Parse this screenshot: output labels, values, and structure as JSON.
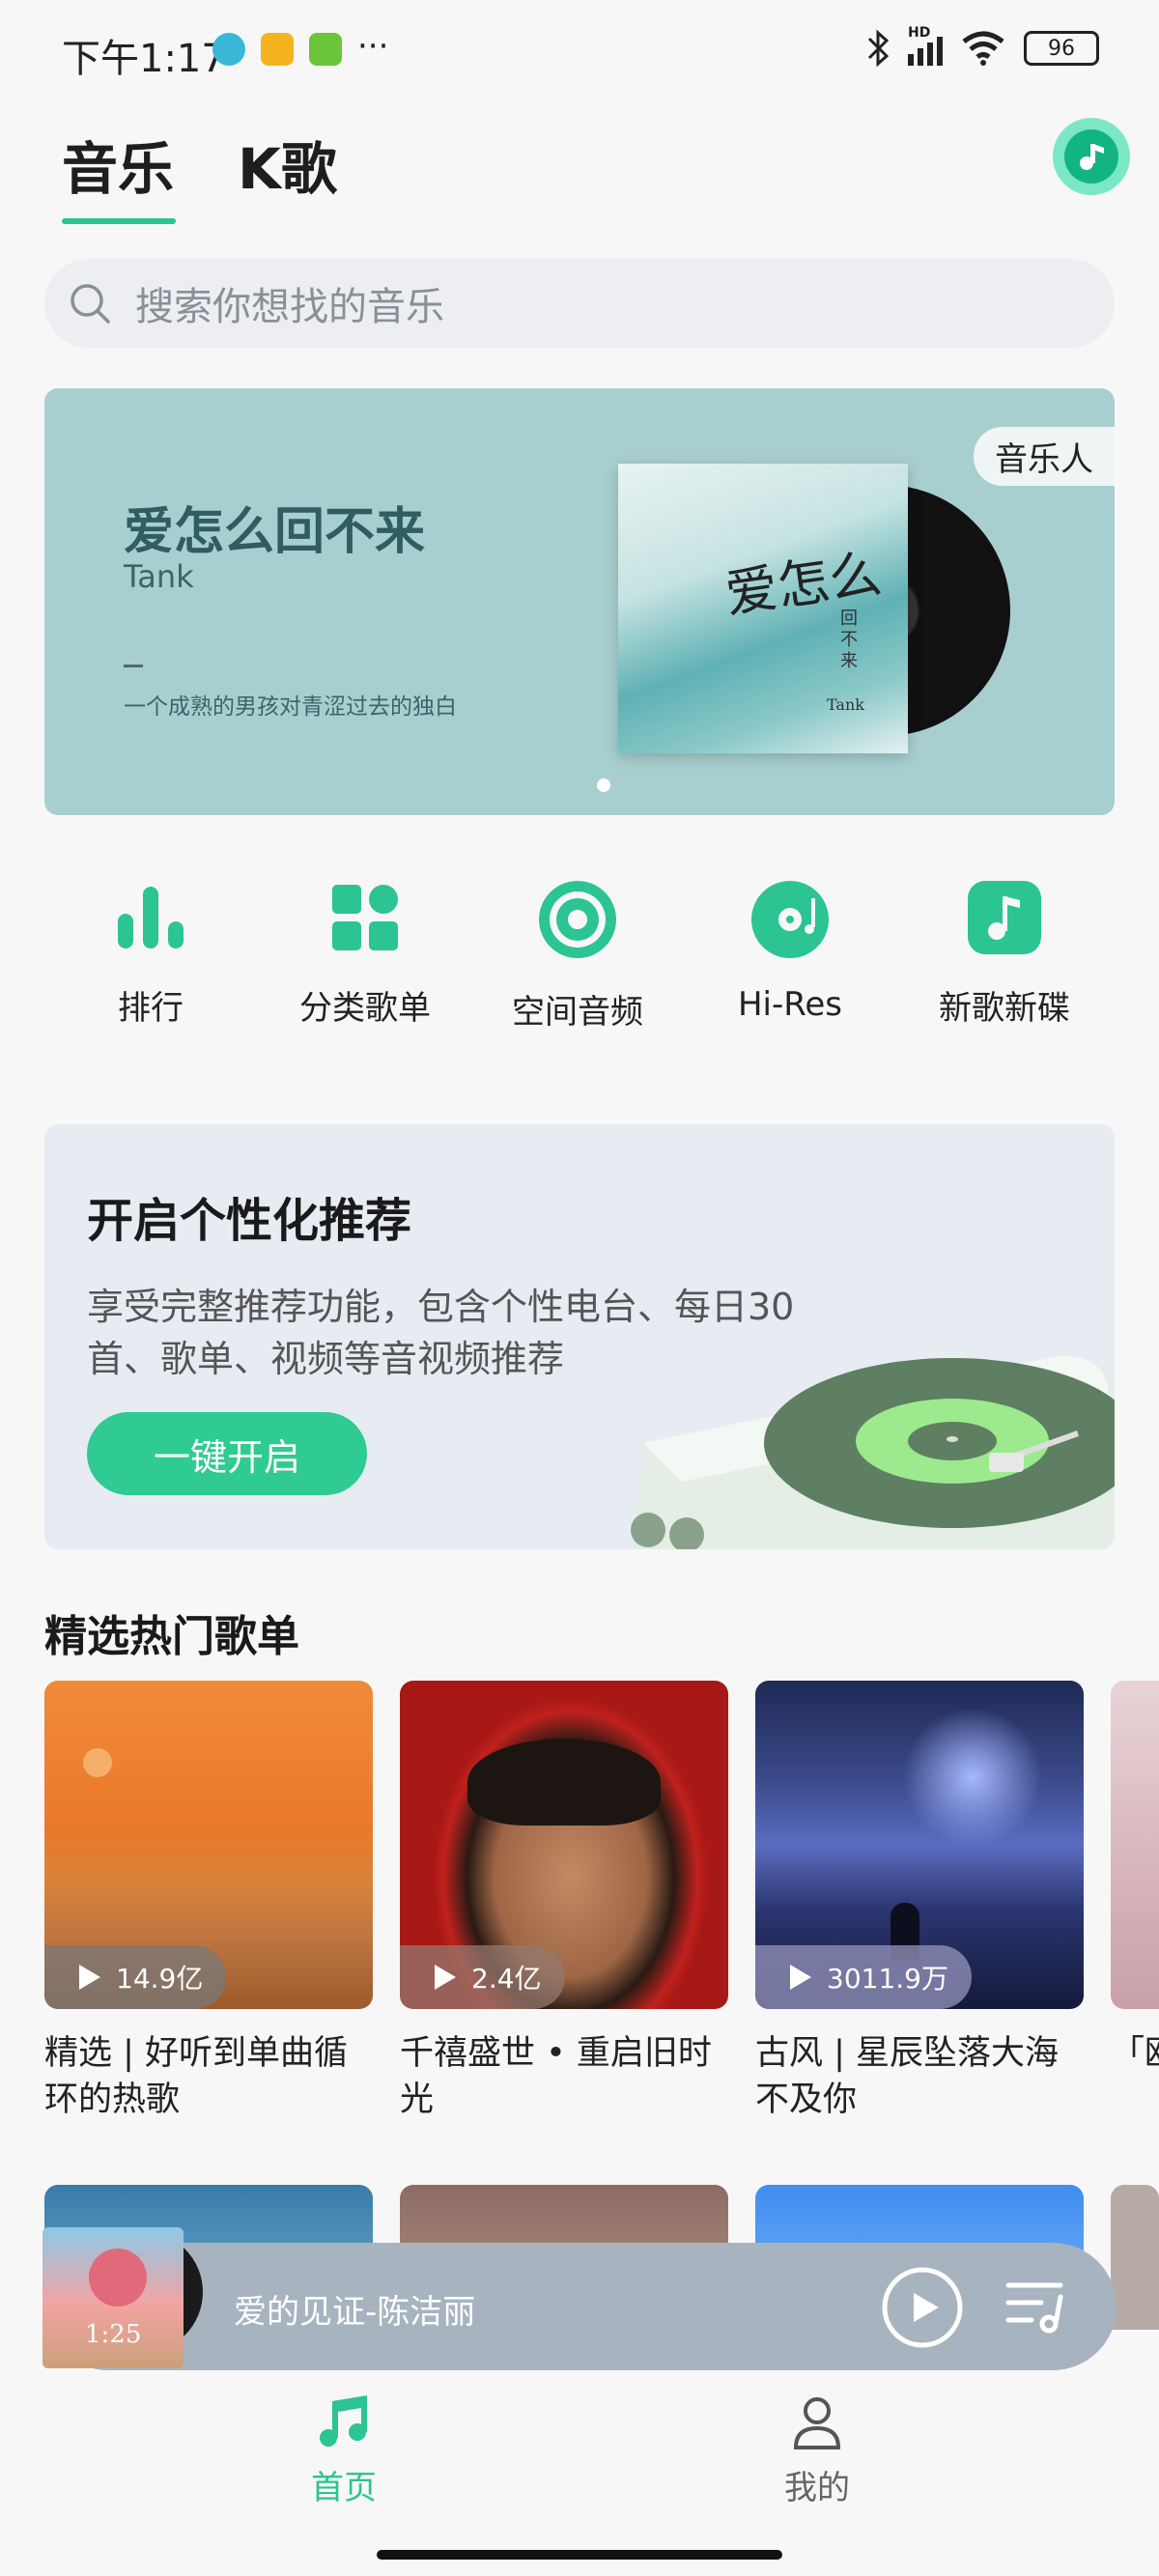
{
  "status_bar": {
    "time": "下午1:17",
    "battery": "96",
    "network": "HD"
  },
  "top_tabs": [
    {
      "label": "音乐",
      "active": true
    },
    {
      "label": "K歌",
      "active": false
    }
  ],
  "search": {
    "placeholder": "搜索你想找的音乐"
  },
  "banner": {
    "title": "爱怎么回不来",
    "artist": "Tank",
    "description": "一个成熟的男孩对青涩过去的独白",
    "tag": "音乐人",
    "album_script": "爱怎么",
    "album_sub": "回不来",
    "album_artist": "Tank"
  },
  "quick_actions": [
    {
      "label": "排行",
      "icon": "bar-chart-icon"
    },
    {
      "label": "分类歌单",
      "icon": "grid-icon"
    },
    {
      "label": "空间音频",
      "icon": "spatial-audio-icon"
    },
    {
      "label": "Hi-Res",
      "icon": "disc-icon"
    },
    {
      "label": "新歌新碟",
      "icon": "music-note-icon"
    }
  ],
  "promo": {
    "title": "开启个性化推荐",
    "description": "享受完整推荐功能，包含个性电台、每日30首、歌单、视频等音视频推荐",
    "button": "一键开启"
  },
  "featured": {
    "title": "精选热门歌单",
    "playlists": [
      {
        "title": "精选 | 好听到单曲循环的热歌",
        "plays": "14.9亿"
      },
      {
        "title": "千禧盛世 • 重启旧时光",
        "plays": "2.4亿"
      },
      {
        "title": "古风 | 星辰坠落大海不及你",
        "plays": "3011.9万"
      },
      {
        "title": "「欧",
        "plays": ""
      }
    ]
  },
  "now_playing": {
    "title": "爱的见证-陈洁丽",
    "cover_text": "1:25"
  },
  "bottom_nav": [
    {
      "label": "首页",
      "active": true
    },
    {
      "label": "我的",
      "active": false
    }
  ],
  "colors": {
    "accent": "#2bc492",
    "banner_bg": "#a8cfd0",
    "player_bg": "#a7b4bf"
  }
}
